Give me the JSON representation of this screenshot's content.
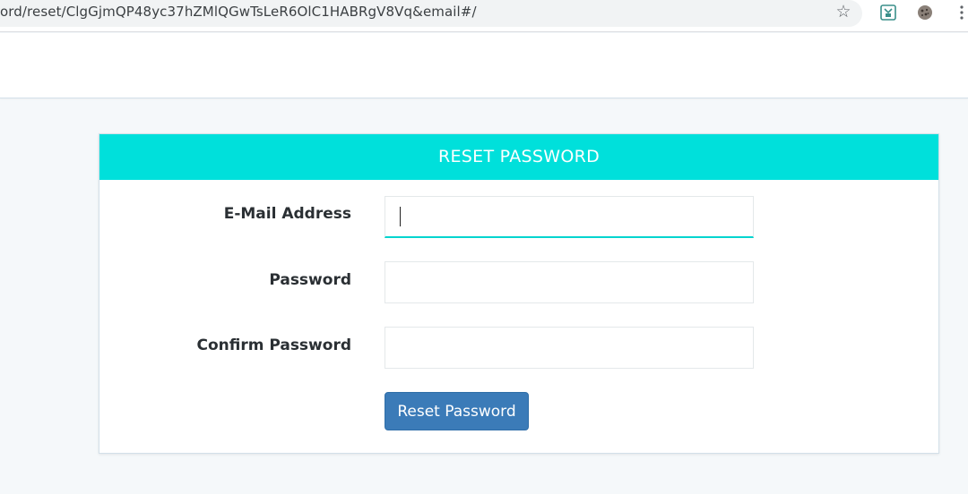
{
  "browser": {
    "url": "ord/reset/ClgGjmQP48yc37hZMlQGwTsLeR6OlC1HABRgV8Vq&email#/",
    "star_icon": "star-icon",
    "extensions": [
      "save-extension-icon",
      "cookie-extension-icon"
    ]
  },
  "panel": {
    "heading": "RESET PASSWORD",
    "heading_color": "#00e0db",
    "fields": {
      "email_label": "E-Mail Address",
      "email_value": "",
      "password_label": "Password",
      "password_value": "",
      "confirm_label": "Confirm Password",
      "confirm_value": ""
    },
    "submit_label": "Reset Password",
    "submit_color": "#3b7bb8"
  }
}
